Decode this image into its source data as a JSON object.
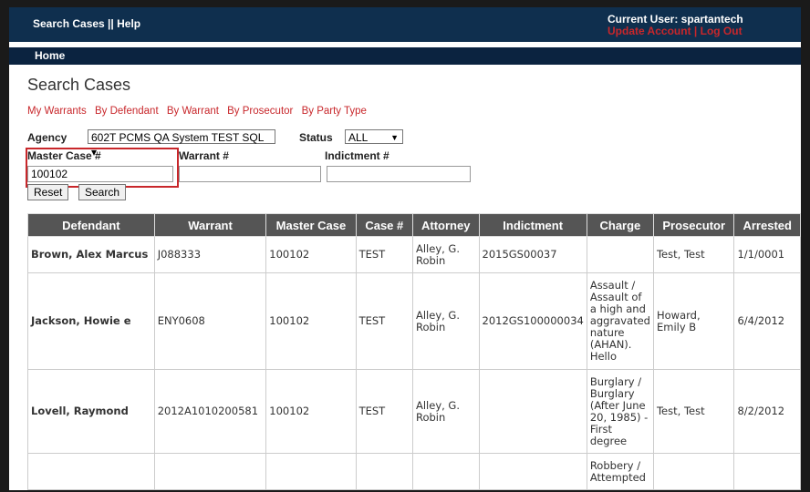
{
  "topnav": {
    "search_cases": "Search Cases ||",
    "help": "Help"
  },
  "user": {
    "current_user": "Current User: spartantech",
    "update_account": "Update Account",
    "separator": "|",
    "log_out": "Log Out"
  },
  "homebar": {
    "home": "Home"
  },
  "page": {
    "title": "Search Cases"
  },
  "subnav": [
    "My Warrants",
    "By Defendant",
    "By Warrant",
    "By Prosecutor",
    "By Party Type"
  ],
  "filters": {
    "agency_label": "Agency",
    "agency_value": "602T PCMS QA System TEST SQL ▾",
    "status_label": "Status",
    "status_value": "ALL",
    "master_case_label": "Master Case #",
    "master_case_value": "100102",
    "warrant_label": "Warrant #",
    "warrant_value": "",
    "indictment_label": "Indictment #",
    "indictment_value": "",
    "reset": "Reset",
    "search": "Search"
  },
  "table": {
    "headers": [
      "Defendant",
      "Warrant",
      "Master Case",
      "Case #",
      "Attorney",
      "Indictment",
      "Charge",
      "Prosecutor",
      "Arrested"
    ],
    "rows": [
      [
        "Brown, Alex Marcus",
        "J088333",
        "100102",
        "TEST",
        "Alley, G. Robin",
        "2015GS00037",
        "",
        "Test, Test",
        "1/1/0001"
      ],
      [
        "Jackson, Howie e",
        "ENY0608",
        "100102",
        "TEST",
        "Alley, G. Robin",
        "2012GS100000034",
        "Assault / Assault of a high and aggravated nature (AHAN). Hello",
        "Howard, Emily B",
        "6/4/2012"
      ],
      [
        "Lovell, Raymond",
        "2012A1010200581",
        "100102",
        "TEST",
        "Alley, G. Robin",
        "",
        "Burglary / Burglary (After June 20, 1985) - First degree",
        "Test, Test",
        "8/2/2012"
      ],
      [
        "",
        "",
        "",
        "",
        "",
        "",
        "Robbery / Attempted",
        "",
        ""
      ]
    ]
  }
}
